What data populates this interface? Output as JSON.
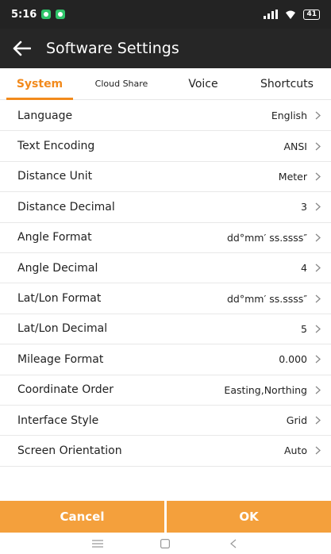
{
  "status_bar": {
    "time": "5:16",
    "battery": "41"
  },
  "app_bar": {
    "title": "Software Settings"
  },
  "tabs": [
    {
      "label": "System"
    },
    {
      "label": "Cloud Share"
    },
    {
      "label": "Voice"
    },
    {
      "label": "Shortcuts"
    }
  ],
  "settings": [
    {
      "label": "Language",
      "value": "English"
    },
    {
      "label": "Text Encoding",
      "value": "ANSI"
    },
    {
      "label": "Distance Unit",
      "value": "Meter"
    },
    {
      "label": "Distance Decimal",
      "value": "3"
    },
    {
      "label": "Angle Format",
      "value": "dd°mm′ ss.ssss″"
    },
    {
      "label": "Angle Decimal",
      "value": "4"
    },
    {
      "label": "Lat/Lon Format",
      "value": "dd°mm′ ss.ssss″"
    },
    {
      "label": "Lat/Lon Decimal",
      "value": "5"
    },
    {
      "label": "Mileage Format",
      "value": "0.000"
    },
    {
      "label": "Coordinate Order",
      "value": "Easting,Northing"
    },
    {
      "label": "Interface Style",
      "value": "Grid"
    },
    {
      "label": "Screen Orientation",
      "value": "Auto"
    }
  ],
  "buttons": {
    "cancel": "Cancel",
    "ok": "OK"
  },
  "colors": {
    "accent": "#f28a1c",
    "button": "#f4a03c",
    "bar": "#262626"
  },
  "icons": [
    "back-arrow-icon",
    "chevron-right-icon",
    "signal-icon",
    "wifi-icon",
    "battery-icon",
    "menu-icon",
    "home-icon",
    "back-icon"
  ]
}
